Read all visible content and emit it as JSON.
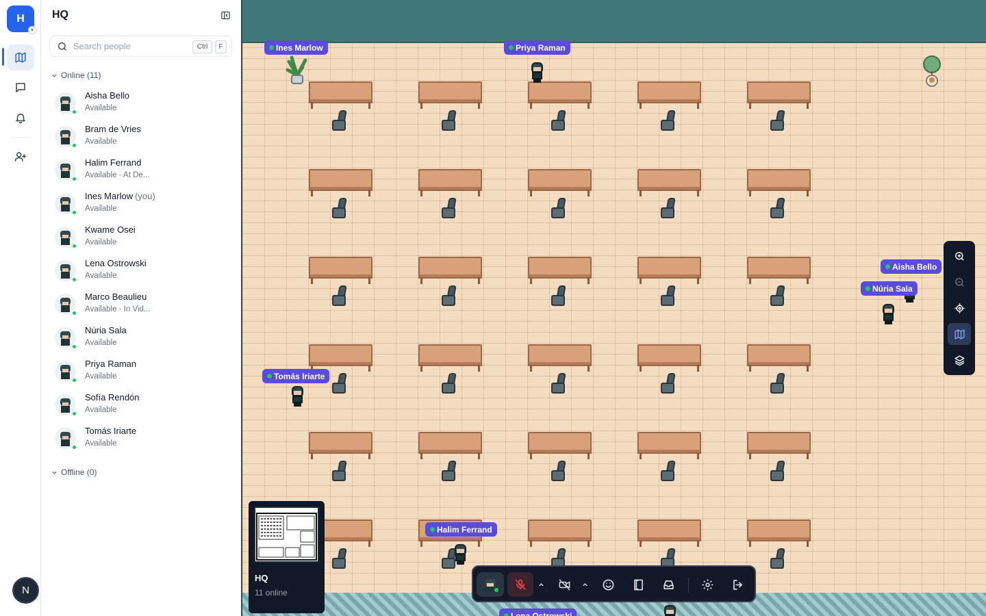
{
  "workspace": {
    "initial": "H",
    "name": "HQ"
  },
  "rail": {
    "items": [
      "map-icon",
      "chat-icon",
      "bell-icon",
      "invite-user-icon"
    ],
    "user_initial": "N"
  },
  "search": {
    "placeholder": "Search people",
    "shortcut_key1": "Ctrl",
    "shortcut_key2": "F"
  },
  "sections": {
    "online": "Online (11)",
    "offline": "Offline (0)"
  },
  "people": [
    {
      "name": "Aisha Bello",
      "you": "",
      "status": "Available"
    },
    {
      "name": "Bram de Vries",
      "you": "",
      "status": "Available"
    },
    {
      "name": "Halim Ferrand",
      "you": "",
      "status": "Available · At De..."
    },
    {
      "name": "Ines Marlow",
      "you": "(you)",
      "status": "Available"
    },
    {
      "name": "Kwame Osei",
      "you": "",
      "status": "Available"
    },
    {
      "name": "Lena Ostrowski",
      "you": "",
      "status": "Available"
    },
    {
      "name": "Marco Beaulieu",
      "you": "",
      "status": "Available · In Vid..."
    },
    {
      "name": "Núria Sala",
      "you": "",
      "status": "Available"
    },
    {
      "name": "Priya Raman",
      "you": "",
      "status": "Available"
    },
    {
      "name": "Sofía Rendón",
      "you": "",
      "status": "Available"
    },
    {
      "name": "Tomás Iriarte",
      "you": "",
      "status": "Available"
    }
  ],
  "map_tags": [
    "Ines Marlow",
    "Priya Raman",
    "Aisha Bello",
    "Núria Sala",
    "Tomás Iriarte",
    "Halim Ferrand",
    "Lena Ostrowski"
  ],
  "minimap": {
    "name": "HQ",
    "count": "11 online"
  },
  "colors": {
    "accent": "#2563eb",
    "tag": "#5b4bdc",
    "online": "#22c55e",
    "wall": "#3f7879",
    "floor": "#f4dcc0"
  }
}
